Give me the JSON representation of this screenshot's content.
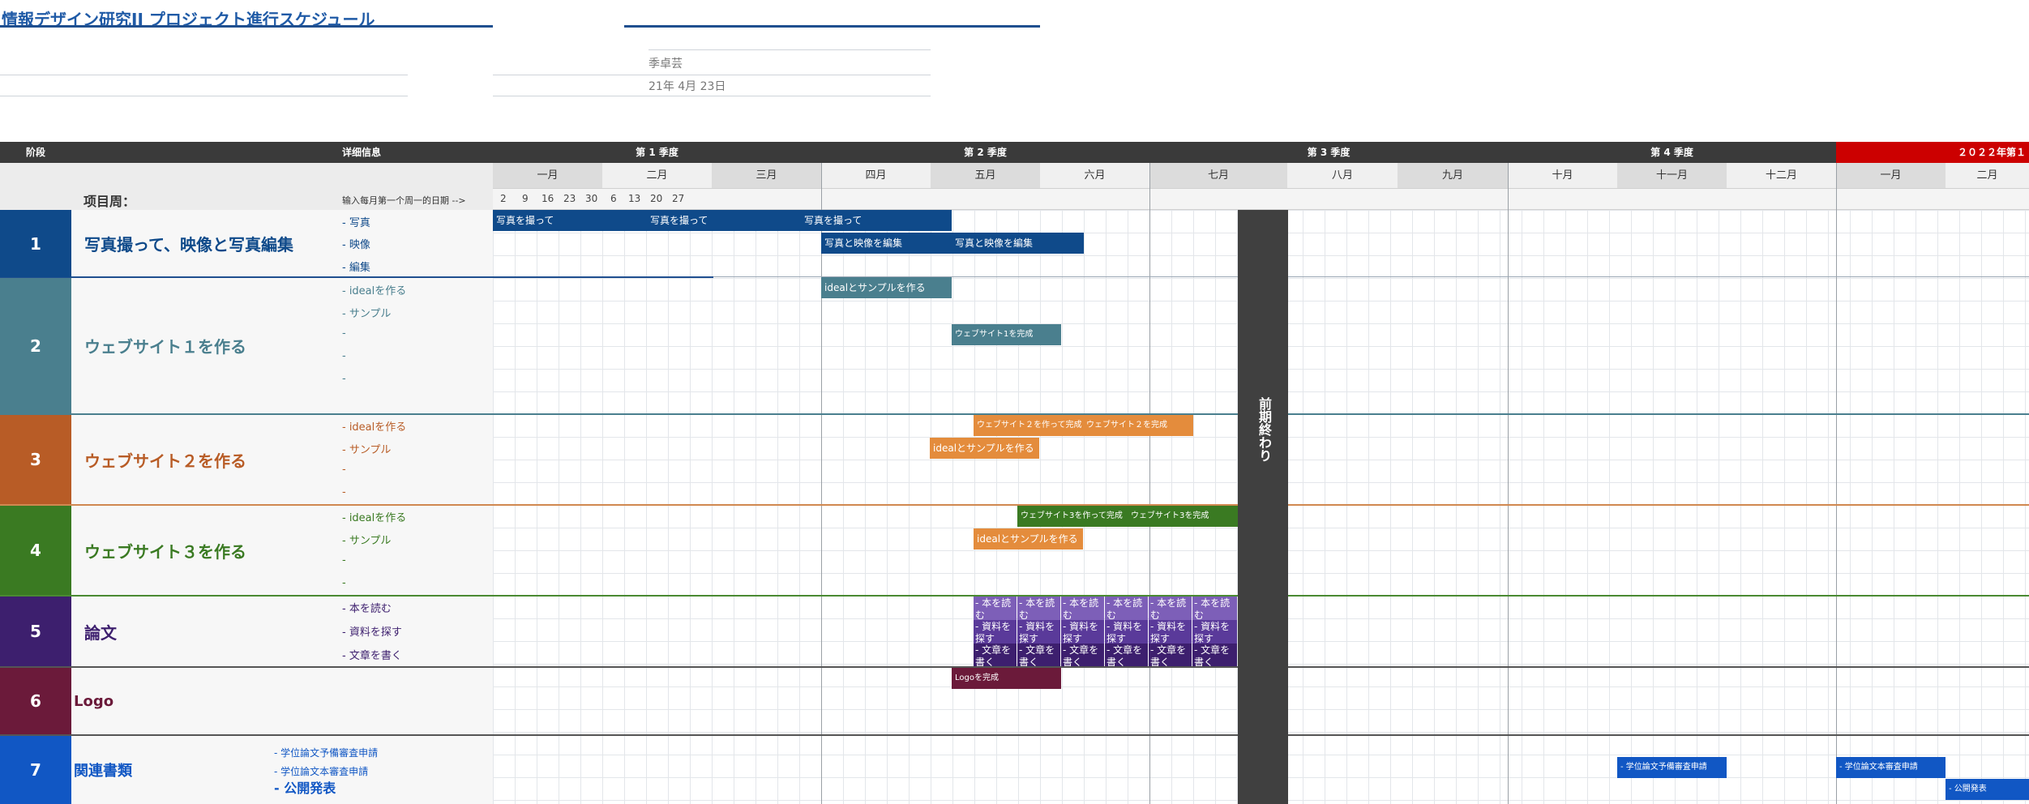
{
  "header": {
    "title": "情報デザイン研究II プロジェクト進行スケジュール",
    "author": "季卓芸",
    "date": "21年 4月 23日"
  },
  "columns": {
    "phase": "阶段",
    "details": "详细信息",
    "project_weeks_label": "项目周：",
    "week_hint": "输入每月第一个周一的日期 -->"
  },
  "quarters": [
    "第 1 季度",
    "第 2 季度",
    "第 3 季度",
    "第 4 季度",
    "２０２２年第１"
  ],
  "months": [
    "一月",
    "二月",
    "三月",
    "四月",
    "五月",
    "六月",
    "七月",
    "八月",
    "九月",
    "十月",
    "十一月",
    "十二月",
    "一月",
    "二月"
  ],
  "week_dates": [
    "2",
    "9",
    "16",
    "23",
    "30",
    "6",
    "13",
    "20",
    "27"
  ],
  "break_label": "前期終わり",
  "phases": [
    {
      "num": "1",
      "title": "写真撮って、映像と写真編集",
      "color": "#0f4a8a",
      "details": [
        "- 写真",
        "- 映像",
        "- 編集"
      ]
    },
    {
      "num": "2",
      "title": "ウェブサイト１を作る",
      "color": "#4a7f8e",
      "details": [
        "- idealを作る",
        "- サンプル",
        "-",
        "-",
        "-"
      ]
    },
    {
      "num": "3",
      "title": "ウェブサイト２を作る",
      "color": "#b85c26",
      "details": [
        "- idealを作る",
        "- サンプル",
        "-",
        "-"
      ]
    },
    {
      "num": "4",
      "title": "ウェブサイト３を作る",
      "color": "#3a7a22",
      "details": [
        "- idealを作る",
        "- サンプル",
        "-",
        "-"
      ]
    },
    {
      "num": "5",
      "title": "論文",
      "color": "#3d1f6e",
      "details": [
        "- 本を読む",
        "- 資料を探す",
        "- 文章を書く"
      ]
    },
    {
      "num": "6",
      "title": "Logo",
      "color": "#6b1a3a",
      "details": []
    },
    {
      "num": "7",
      "title": "関連書類",
      "color": "#1157c4",
      "details": [
        "- 学位論文予備審査申請",
        "- 学位論文本審査申請",
        "- 公開発表"
      ]
    }
  ],
  "bars": {
    "shoot1": "写真を撮って",
    "shoot2": "写真を撮って",
    "shoot3": "写真を撮って",
    "edit1": "写真と映像を編集",
    "edit2": "写真と映像を編集",
    "w1_ideal": "idealとサンプルを作る",
    "w1_done": "ウェブサイト1を完成",
    "w2_a": "ウェブサイト２を作って完成",
    "w2_b": "ウェブサイト２を完成",
    "w2_ideal": "idealとサンプルを作る",
    "w3_a": "ウェブサイト3を作って完成",
    "w3_b": "ウェブサイト3を完成",
    "w3_ideal": "idealとサンプルを作る",
    "read": "- 本を読む",
    "search": "- 資料を探す",
    "write": "- 文章を書く",
    "logo": "Logoを完成",
    "doc1": "- 学位論文予備審査申請",
    "doc2": "- 学位論文本審査申請",
    "doc3": "- 公開発表"
  },
  "colors": {
    "dark": "#3a3a3a",
    "accent_red": "#cc0000",
    "break_block": "#404040",
    "website3_bar": "#3a7a22",
    "website2_bar": "#e48c3c",
    "paper_light": "#7d5fb8",
    "paper_mid": "#5a3a9a",
    "paper_dark": "#3d1f6e"
  }
}
